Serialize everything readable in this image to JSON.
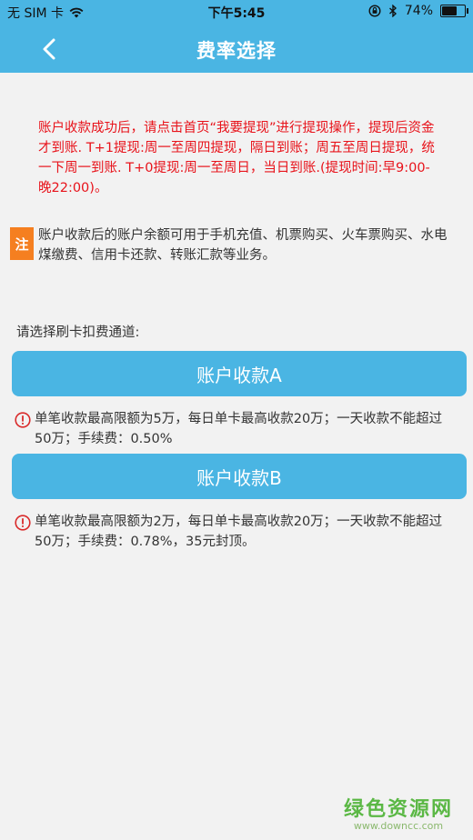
{
  "status_bar": {
    "carrier": "无 SIM 卡",
    "time": "下午5:45",
    "battery": "74%",
    "battery_level": 0.74
  },
  "nav": {
    "title": "费率选择"
  },
  "notice": {
    "text": "账户收款成功后，请点击首页“我要提现”进行提现操作，提现后资金才到账. T+1提现:周一至周四提现，隔日到账；周五至周日提现，统一下周一到账. T+0提现:周一至周日，当日到账.(提现时间:早9:00-晚22:00)。"
  },
  "note": {
    "badge": "注",
    "text": "账户收款后的账户余额可用于手机充值、机票购买、火车票购买、水电煤缴费、信用卡还款、转账汇款等业务。"
  },
  "choose_label": "请选择刷卡扣费通道:",
  "channels": [
    {
      "button_label": "账户收款A",
      "description": "单笔收款最高限额为5万，每日单卡最高收款20万；一天收款不能超过50万；手续费：0.50%"
    },
    {
      "button_label": "账户收款B",
      "description": "单笔收款最高限额为2万，每日单卡最高收款20万；一天收款不能超过50万；手续费：0.78%，35元封顶。"
    }
  ],
  "watermark": {
    "main": "绿色资源网",
    "sub": "www.downcc.com"
  },
  "colors": {
    "accent": "#4ab5e3",
    "notice_red": "#e8131b",
    "badge_orange": "#f57f20",
    "warn_red": "#d92b2b"
  }
}
